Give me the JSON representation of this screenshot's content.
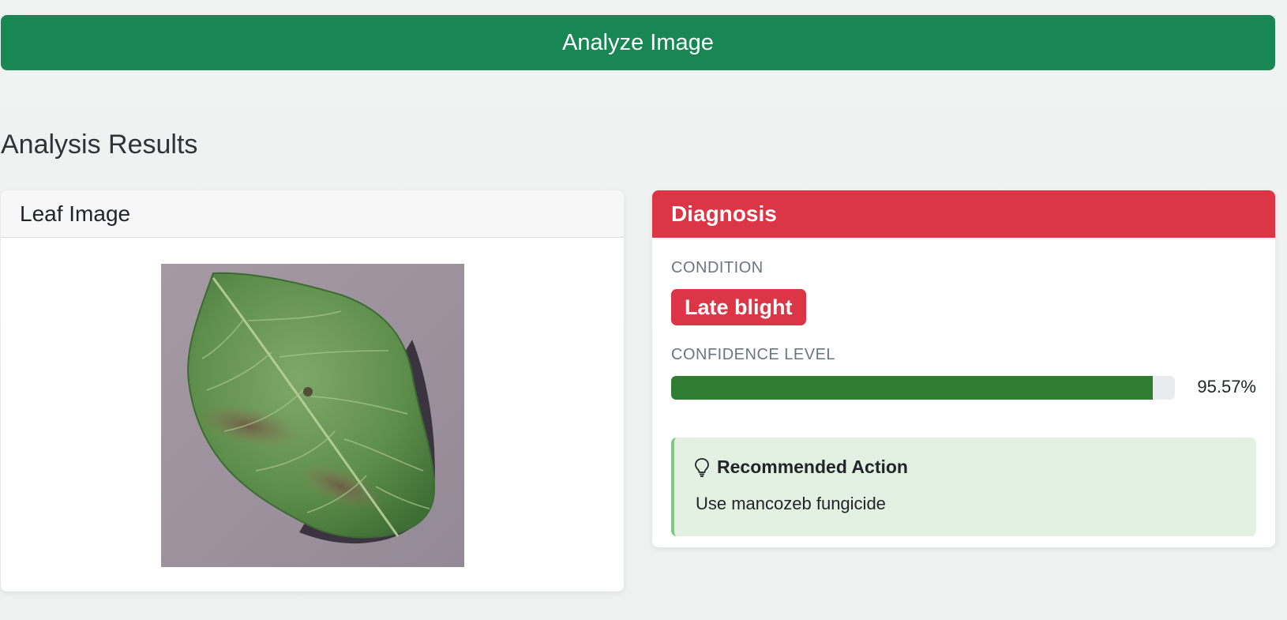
{
  "analyze_button": {
    "label": "Analyze Image"
  },
  "results": {
    "title": "Analysis Results",
    "leaf_card": {
      "title": "Leaf Image"
    },
    "diagnosis_card": {
      "title": "Diagnosis",
      "condition_label": "CONDITION",
      "condition_value": "Late blight",
      "confidence_label": "CONFIDENCE LEVEL",
      "confidence_value": 0.9557,
      "confidence_text": "95.57%",
      "recommendation": {
        "icon": "lightbulb-icon",
        "title": "Recommended Action",
        "text": "Use mancozeb fungicide"
      }
    }
  },
  "colors": {
    "primary_green": "#198754",
    "danger_red": "#dc3545",
    "progress_green": "#2e7d32",
    "recommendation_bg": "#e3f1e3",
    "recommendation_border": "#81c784"
  }
}
